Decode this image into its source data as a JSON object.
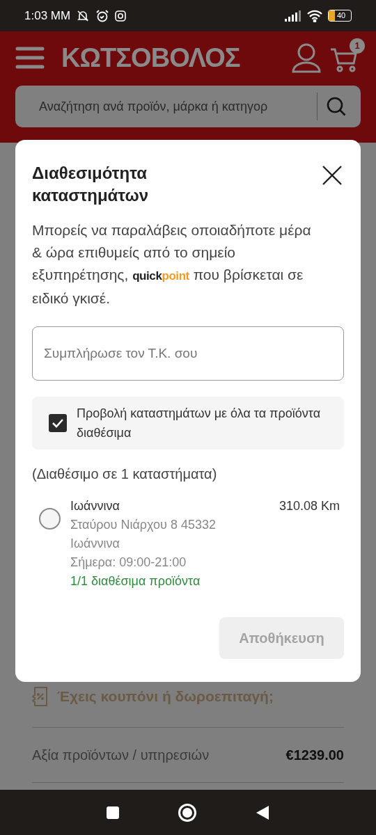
{
  "status_bar": {
    "time": "1:03 MM",
    "battery": "40"
  },
  "header": {
    "logo": "ΚΩΤΣΟΒΟΛΟΣ",
    "cart_count": "1",
    "search": {
      "placeholder": "Αναζήτηση ανά προϊόν, μάρκα ή κατηγορ"
    }
  },
  "background": {
    "coupon": "Έχεις κουπόνι ή δωροεπιταγή;",
    "summary_label": "Αξία προϊόντων / υπηρεσιών",
    "summary_value": "€1239.00"
  },
  "modal": {
    "title": "Διαθεσιμότητα καταστημάτων",
    "intro": {
      "before": "Μπορείς να παραλάβεις οποιαδήποτε μέρα & ώρα επιθυμείς από το σημείο εξυπηρέτησης, ",
      "logo_first": "quick",
      "logo_second": "point",
      "after": " που βρίσκεται σε ειδικό γκισέ."
    },
    "postcode": {
      "placeholder": "Συμπλήρωσε τον Τ.Κ. σου"
    },
    "filter": {
      "label": "Προβολή καταστημάτων με όλα τα προϊόντα διαθέσιμα",
      "checked": true
    },
    "count": "(Διαθέσιμο σε 1 καταστήματα)",
    "stores": [
      {
        "name": "Ιωάννινα",
        "address": "Σταύρου Νιάρχου 8 45332",
        "city": "Ιωάννινα",
        "hours": "Σήμερα: 09:00-21:00",
        "availability": "1/1 διαθέσιμα προϊόντα",
        "distance": "310.08 Km",
        "selected": false
      }
    ],
    "save_button": {
      "label": "Αποθήκευση",
      "disabled": true
    }
  }
}
